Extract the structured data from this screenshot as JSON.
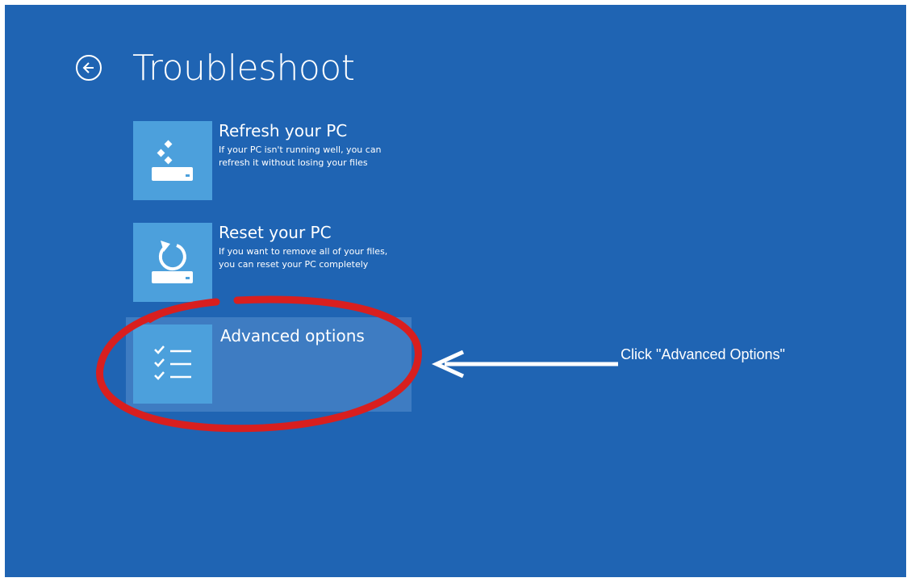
{
  "page": {
    "title": "Troubleshoot",
    "back_icon": "back-arrow-icon",
    "background_color": "#1f64b3",
    "tile_color": "#4ca0dc"
  },
  "options": [
    {
      "title": "Refresh your PC",
      "description": "If your PC isn't running well, you can refresh it without losing your files",
      "icon": "refresh-drive-icon"
    },
    {
      "title": "Reset your PC",
      "description": "If you want to remove all of your files, you can reset your PC completely",
      "icon": "reset-drive-icon"
    },
    {
      "title": "Advanced options",
      "description": "",
      "icon": "checklist-icon"
    }
  ],
  "annotation": {
    "callout": "Click \"Advanced Options\"",
    "ring_color": "#d81f1f",
    "arrow_color": "#ffffff"
  }
}
